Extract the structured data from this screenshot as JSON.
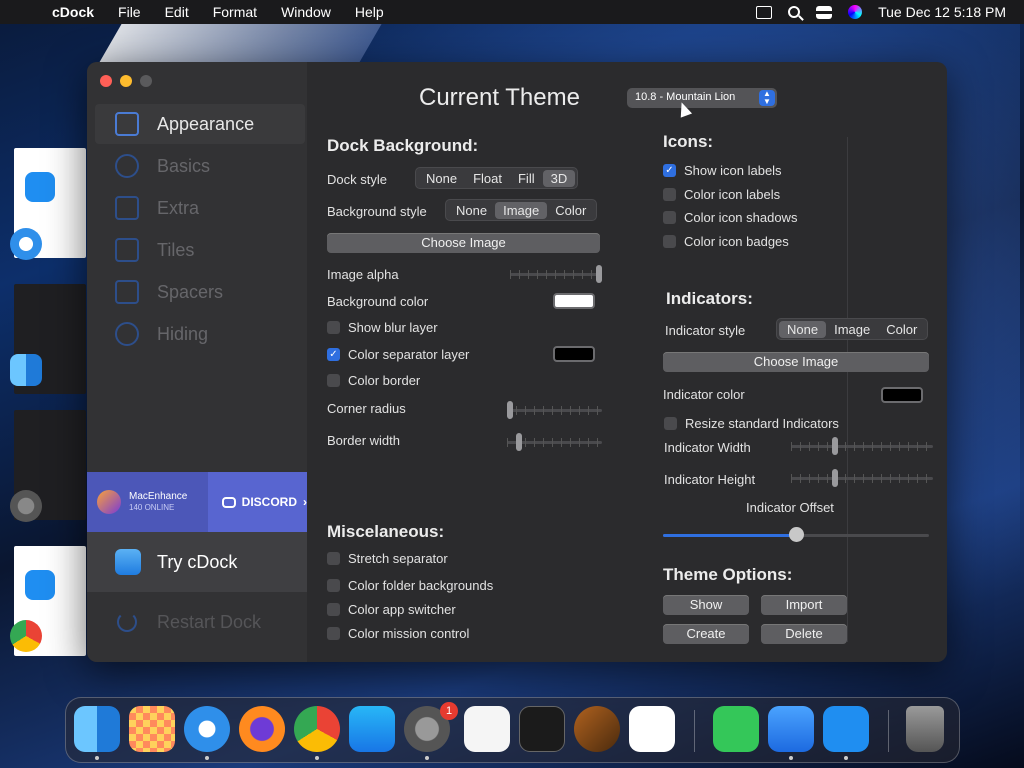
{
  "menubar": {
    "app": "cDock",
    "items": [
      "File",
      "Edit",
      "Format",
      "Window",
      "Help"
    ],
    "datetime": "Tue Dec 12  5:18 PM"
  },
  "sidebar": {
    "items": [
      {
        "label": "Appearance",
        "icon": "paintbrush-icon",
        "active": true
      },
      {
        "label": "Basics",
        "icon": "gauge-icon"
      },
      {
        "label": "Extra",
        "icon": "grid-icon"
      },
      {
        "label": "Tiles",
        "icon": "trash-icon"
      },
      {
        "label": "Spacers",
        "icon": "spacer-icon"
      },
      {
        "label": "Hiding",
        "icon": "eye-slash-icon"
      }
    ],
    "promo": {
      "brand": "MacEnhance",
      "online": "140 ONLINE",
      "discord": "DISCORD"
    },
    "try_label": "Try cDock",
    "restart_label": "Restart Dock"
  },
  "header": {
    "title": "Current Theme",
    "theme_select": "10.8 - Mountain Lion"
  },
  "dock_background": {
    "heading": "Dock Background:",
    "dock_style_label": "Dock style",
    "dock_style_options": [
      "None",
      "Float",
      "Fill",
      "3D"
    ],
    "dock_style_selected": "3D",
    "bg_style_label": "Background style",
    "bg_style_options": [
      "None",
      "Image",
      "Color"
    ],
    "bg_style_selected": "Image",
    "choose_image": "Choose Image",
    "image_alpha_label": "Image alpha",
    "image_alpha": 1.0,
    "bg_color_label": "Background color",
    "bg_color": "#ffffff",
    "show_blur_label": "Show blur layer",
    "show_blur": false,
    "color_sep_label": "Color separator layer",
    "color_sep": true,
    "sep_color": "#000000",
    "color_border_label": "Color border",
    "color_border": false,
    "corner_radius_label": "Corner radius",
    "corner_radius": 0.0,
    "border_width_label": "Border width",
    "border_width": 0.1
  },
  "misc": {
    "heading": "Miscelaneous:",
    "items": [
      {
        "label": "Stretch separator",
        "checked": false
      },
      {
        "label": "Color folder backgrounds",
        "checked": false
      },
      {
        "label": "Color app switcher",
        "checked": false
      },
      {
        "label": "Color mission control",
        "checked": false
      }
    ]
  },
  "icons": {
    "heading": "Icons:",
    "items": [
      {
        "label": "Show icon labels",
        "checked": true
      },
      {
        "label": "Color icon labels",
        "checked": false
      },
      {
        "label": "Color icon shadows",
        "checked": false
      },
      {
        "label": "Color icon badges",
        "checked": false
      }
    ]
  },
  "indicators": {
    "heading": "Indicators:",
    "style_label": "Indicator style",
    "style_options": [
      "None",
      "Image",
      "Color"
    ],
    "style_selected": "None",
    "choose_image": "Choose Image",
    "color_label": "Indicator color",
    "color": "#000000",
    "resize_label": "Resize standard Indicators",
    "resize": false,
    "width_label": "Indicator Width",
    "width": 0.3,
    "height_label": "Indicator Height",
    "height": 0.3,
    "offset_label": "Indicator Offset",
    "offset": 0.5
  },
  "theme_options": {
    "heading": "Theme Options:",
    "show": "Show",
    "import": "Import",
    "create": "Create",
    "delete": "Delete"
  },
  "dock": {
    "apps": [
      "finder-icon",
      "launchpad-icon",
      "safari-icon",
      "firefox-icon",
      "chrome-icon",
      "app-store-icon",
      "system-settings-icon",
      "textedit-icon",
      "terminal-icon",
      "garageband-icon",
      "vscode-icon",
      "messages-icon",
      "keynote-icon",
      "cdock-icon",
      "trash-icon"
    ],
    "settings_badge": "1"
  },
  "colors": {
    "accent": "#2f6fe0",
    "window_bg": "#2b2b2d",
    "sidebar_bg": "#323234",
    "promo_bg": "#5865d0"
  }
}
